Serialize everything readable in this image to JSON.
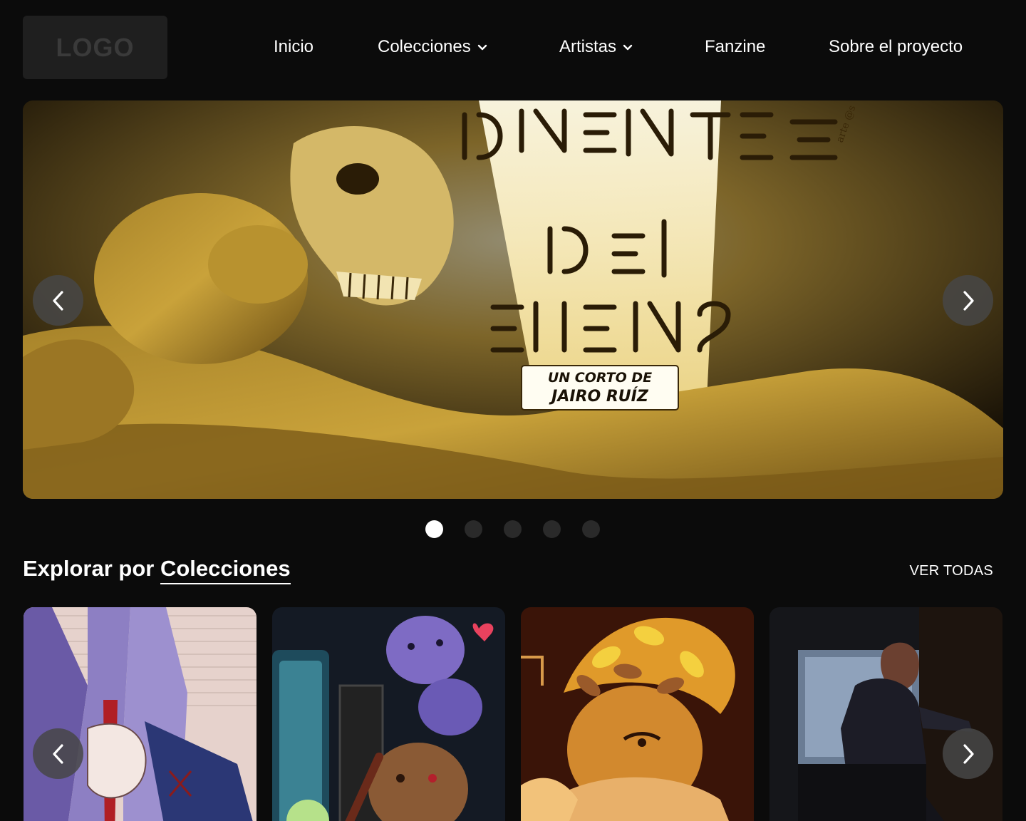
{
  "header": {
    "logo_text": "LOGO",
    "nav": [
      {
        "label": "Inicio",
        "has_dropdown": false
      },
      {
        "label": "Colecciones",
        "has_dropdown": true
      },
      {
        "label": "Artistas",
        "has_dropdown": true
      },
      {
        "label": "Fanzine",
        "has_dropdown": false
      },
      {
        "label": "Sobre el proyecto",
        "has_dropdown": false
      }
    ]
  },
  "hero": {
    "credit_text": "arte @s",
    "poster_subtitle_line1": "UN CORTO DE",
    "poster_subtitle_line2": "JAIRO RUÍZ",
    "prev_icon": "chevron-left-icon",
    "next_icon": "chevron-right-icon",
    "slide_count": 5,
    "active_slide": 1
  },
  "collections": {
    "title_prefix": "Explorar por",
    "title_highlight": "Colecciones",
    "see_all_label": "VER TODAS",
    "prev_icon": "chevron-left-icon",
    "next_icon": "chevron-right-icon"
  },
  "colors": {
    "background": "#0b0b0b",
    "logo_bg": "#1f1f1f",
    "arrow_bg": "#464646",
    "dot_active": "#ffffff",
    "dot_inactive": "#2a2a2a",
    "hero_gold": "#c9a23a"
  }
}
